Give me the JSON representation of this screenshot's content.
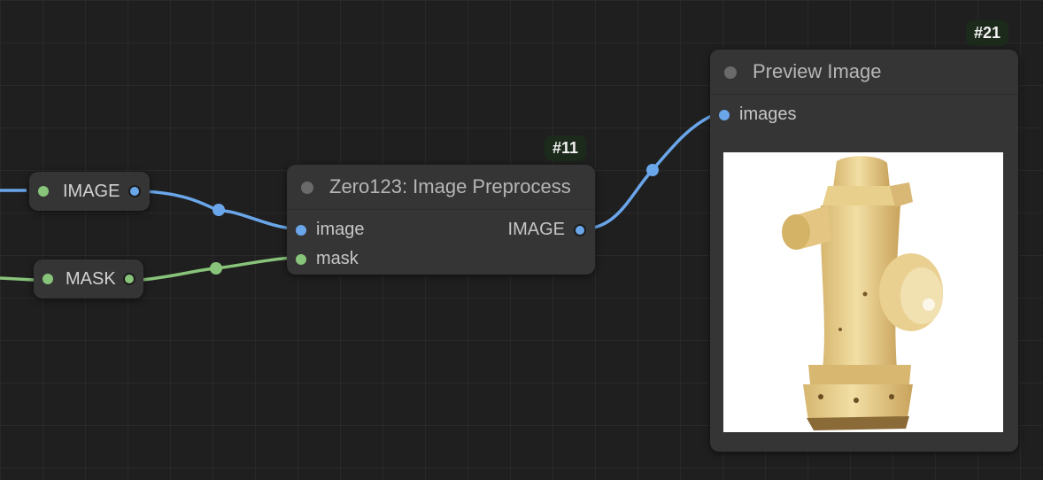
{
  "reroute_image": {
    "label": "IMAGE",
    "color": "#6aa6ea"
  },
  "reroute_mask": {
    "label": "MASK",
    "color": "#88c47a"
  },
  "preprocess_node": {
    "id": "#11",
    "title": "Zero123: Image Preprocess",
    "inputs": [
      "image",
      "mask"
    ],
    "output": "IMAGE"
  },
  "preview_node": {
    "id": "#21",
    "title": "Preview Image",
    "input": "images",
    "image_subject": "yellow fire hydrant"
  },
  "colors": {
    "image_link": "#6aa6ea",
    "mask_link": "#88c47a",
    "canvas": "#1f1f1f",
    "node": "#353535"
  }
}
